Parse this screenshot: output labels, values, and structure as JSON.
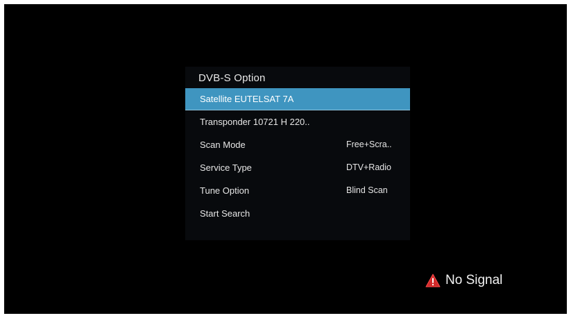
{
  "colors": {
    "background": "#000000",
    "highlight": "#3f95c0",
    "warning": "#d32b2b"
  },
  "menu": {
    "title": "DVB-S Option",
    "selected_index": 0,
    "items": [
      {
        "label": "Satellite EUTELSAT 7A",
        "value": ""
      },
      {
        "label": "Transponder 10721 H 220..",
        "value": ""
      },
      {
        "label": "Scan Mode",
        "value": "Free+Scra.."
      },
      {
        "label": "Service Type",
        "value": "DTV+Radio"
      },
      {
        "label": "Tune Option",
        "value": "Blind Scan"
      },
      {
        "label": "Start Search",
        "value": ""
      }
    ]
  },
  "status": {
    "icon": "warning-icon",
    "text": "No Signal"
  }
}
